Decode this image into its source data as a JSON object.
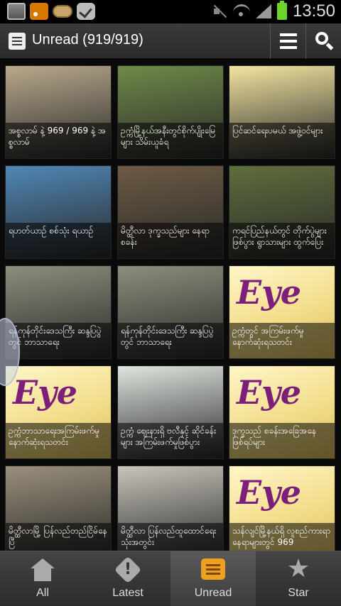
{
  "status_bar": {
    "time": "13:50"
  },
  "action_bar": {
    "title": "Unread (919/919)"
  },
  "icons": {
    "app": "list-document-icon",
    "list_view": "list-view-icon",
    "search": "search-icon"
  },
  "tiles": [
    {
      "caption": "အစ္စလာမ် နဲ့ 969 / 969 နဲ့ အစ္စလာမ်",
      "bg": "#b9a98c"
    },
    {
      "caption": "ဥက္ကံမြို့နယ်အနီးတွင်စိုက်ပျိုးမြေများ သိမ်းယူခံရ",
      "bg": "#6f8a48"
    },
    {
      "caption": "ပြင်ဆင်ရေးပမယ် အဖွဲ့ဝင်များ",
      "bg": "#f2e4a0"
    },
    {
      "caption": "ရဟတ်ယာဉ် စစ်သုံး ရယာဉ်",
      "bg": "#4f87b6"
    },
    {
      "caption": "မိတ္ထီလာ ဒုက္ခသည်များ နေရာ စခန်း",
      "bg": "#6c5a43"
    },
    {
      "caption": "ကရင်ပြည်နယ်တွင် တိုက်ပွဲများဖြစ်ပွား ရွာသားများ ထွက်ပြေး",
      "bg": "#5f6e3c"
    },
    {
      "caption": "ရန်ကုန်တိုင်းဒေသကြီး ဆန္ဒပြပွဲတွင် ဘာသာရေး",
      "bg": "#8b8f7c"
    },
    {
      "caption": "ရန်ကုန်တိုင်းဒေသကြီး ဆန္ဒပြပွဲတွင် ဘာသာရေး",
      "bg": "#8b8f7c"
    },
    {
      "caption": "ဥက္ကံတွင် အကြမ်းဖက်မှု နောက်ဆုံးရသတင်း",
      "bg": "#f2dd8a",
      "eye": true
    },
    {
      "caption": "ဥက္ကံဘာသာရေးအကြမ်းဖက်မှု နောက်ဆုံးရသတင်း",
      "bg": "#f2dd8a",
      "eye": true
    },
    {
      "caption": "ဥက္ကံ ဈေးနားရှိ ဗလီနှင့် ဆိုင်ခန်းများ အကြမ်းဖက်မှုဖြစ်ပွား",
      "bg": "#dfe5df"
    },
    {
      "caption": "ဒုက္ခသည် စခန်းအခြေအနေ ဖြစ်ရပ်များ",
      "bg": "#f2dd8a",
      "eye": true
    },
    {
      "caption": "မိတ္ထီလာမြို့ ပြန်လည်တည်ငြိမ်နေပြီ",
      "bg": "#9a8f7a"
    },
    {
      "caption": "မိတ္ထီလာ ပြန်လည်ထူထောင်ရေး သုံးအတွင်း",
      "bg": "#c8c5bb"
    },
    {
      "caption": "သန်လျင်မြို့နယ်ရှိ လူစည်ကားရာနေရာများတွင် 969",
      "bg": "#f2dd8a",
      "eye": true
    }
  ],
  "eye_word": "Eye",
  "nav": [
    {
      "label": "All",
      "icon": "home-icon"
    },
    {
      "label": "Latest",
      "icon": "alert-icon"
    },
    {
      "label": "Unread",
      "icon": "unread-icon",
      "active": true
    },
    {
      "label": "Star",
      "icon": "star-icon"
    }
  ]
}
